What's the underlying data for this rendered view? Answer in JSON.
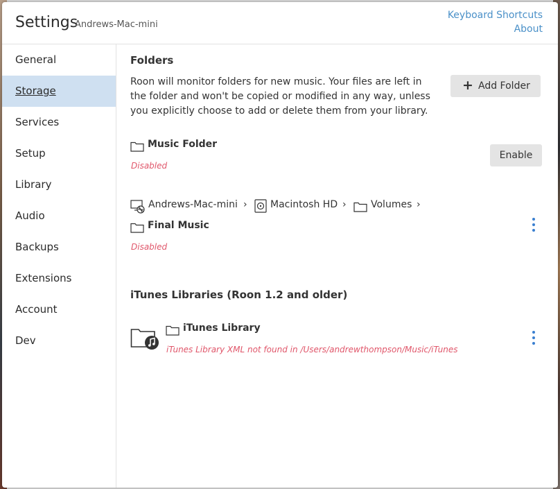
{
  "header": {
    "title": "Settings",
    "subtitle": "Andrews-Mac-mini",
    "links": [
      "Keyboard Shortcuts",
      "About"
    ]
  },
  "sidebar": {
    "items": [
      {
        "label": "General"
      },
      {
        "label": "Storage",
        "active": true
      },
      {
        "label": "Services"
      },
      {
        "label": "Setup"
      },
      {
        "label": "Library"
      },
      {
        "label": "Audio"
      },
      {
        "label": "Backups"
      },
      {
        "label": "Extensions"
      },
      {
        "label": "Account"
      },
      {
        "label": "Dev"
      }
    ]
  },
  "folders": {
    "heading": "Folders",
    "description": "Roon will monitor folders for new music. Your files are left in the folder and won't be copied or modified in any way, unless you explicitly choose to add or delete them from your library.",
    "add_button": "Add Folder",
    "entries": [
      {
        "name": "Music Folder",
        "status": "Disabled",
        "action": "Enable"
      },
      {
        "path": [
          "Andrews-Mac-mini",
          "Macintosh HD",
          "Volumes"
        ],
        "name": "Final Music",
        "status": "Disabled"
      }
    ]
  },
  "itunes": {
    "heading": "iTunes Libraries (Roon 1.2 and older)",
    "entries": [
      {
        "name": "iTunes Library",
        "status": "iTunes Library XML not found in /Users/andrewthompson/Music/iTunes"
      }
    ]
  },
  "colors": {
    "accent": "#4a90c8",
    "active_nav": "#cfe0f1",
    "error": "#e0566a",
    "kebab": "#3a7fd0"
  },
  "icons": {
    "folder": "folder-icon",
    "computer": "computer-icon",
    "drive": "hard-drive-icon",
    "itunes": "itunes-folder-icon",
    "more": "more-vertical-icon",
    "add": "plus-icon",
    "chevron": "chevron-right-icon"
  }
}
